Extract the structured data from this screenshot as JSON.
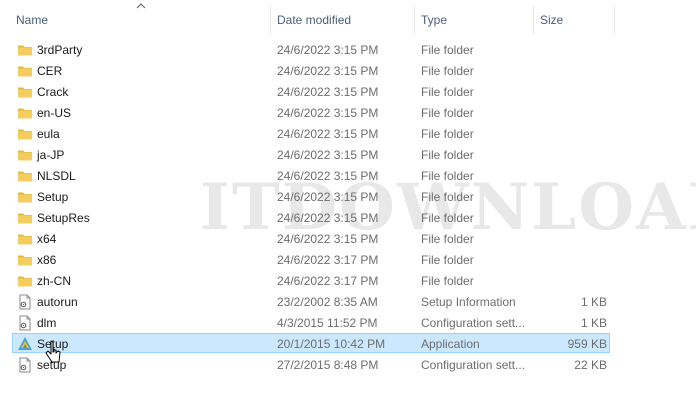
{
  "columns": {
    "name": "Name",
    "date": "Date modified",
    "type": "Type",
    "size": "Size"
  },
  "watermark": "ITDOWNLOAD.COM",
  "colors": {
    "folder": "#f0c44c",
    "selection": "#cce8ff",
    "selection_border": "#99d1ff",
    "header_text": "#4c607a"
  },
  "files": [
    {
      "name": "3rdParty",
      "date": "24/6/2022 3:15 PM",
      "type": "File folder",
      "size": "",
      "icon": "folder-icon"
    },
    {
      "name": "CER",
      "date": "24/6/2022 3:15 PM",
      "type": "File folder",
      "size": "",
      "icon": "folder-icon"
    },
    {
      "name": "Crack",
      "date": "24/6/2022 3:15 PM",
      "type": "File folder",
      "size": "",
      "icon": "folder-icon"
    },
    {
      "name": "en-US",
      "date": "24/6/2022 3:15 PM",
      "type": "File folder",
      "size": "",
      "icon": "folder-icon"
    },
    {
      "name": "eula",
      "date": "24/6/2022 3:15 PM",
      "type": "File folder",
      "size": "",
      "icon": "folder-icon"
    },
    {
      "name": "ja-JP",
      "date": "24/6/2022 3:15 PM",
      "type": "File folder",
      "size": "",
      "icon": "folder-icon"
    },
    {
      "name": "NLSDL",
      "date": "24/6/2022 3:15 PM",
      "type": "File folder",
      "size": "",
      "icon": "folder-icon"
    },
    {
      "name": "Setup",
      "date": "24/6/2022 3:15 PM",
      "type": "File folder",
      "size": "",
      "icon": "folder-icon"
    },
    {
      "name": "SetupRes",
      "date": "24/6/2022 3:15 PM",
      "type": "File folder",
      "size": "",
      "icon": "folder-icon"
    },
    {
      "name": "x64",
      "date": "24/6/2022 3:15 PM",
      "type": "File folder",
      "size": "",
      "icon": "folder-icon"
    },
    {
      "name": "x86",
      "date": "24/6/2022 3:17 PM",
      "type": "File folder",
      "size": "",
      "icon": "folder-icon"
    },
    {
      "name": "zh-CN",
      "date": "24/6/2022 3:17 PM",
      "type": "File folder",
      "size": "",
      "icon": "folder-icon"
    },
    {
      "name": "autorun",
      "date": "23/2/2002 8:35 AM",
      "type": "Setup Information",
      "size": "1 KB",
      "icon": "settings-file-icon"
    },
    {
      "name": "dlm",
      "date": "4/3/2015 11:52 PM",
      "type": "Configuration sett...",
      "size": "1 KB",
      "icon": "settings-file-icon"
    },
    {
      "name": "Setup",
      "date": "20/1/2015 10:42 PM",
      "type": "Application",
      "size": "959 KB",
      "icon": "application-icon",
      "selected": true
    },
    {
      "name": "setup",
      "date": "27/2/2015 8:48 PM",
      "type": "Configuration sett...",
      "size": "22 KB",
      "icon": "settings-file-icon"
    }
  ]
}
